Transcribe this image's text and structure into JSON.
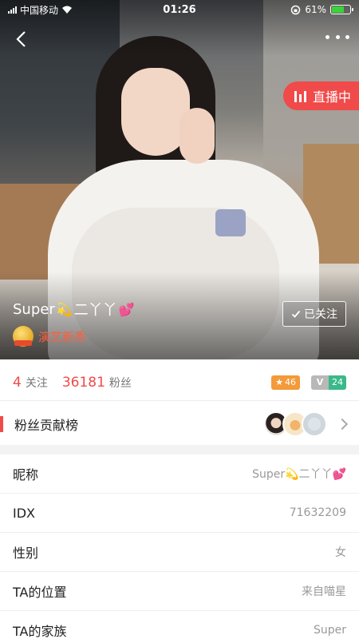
{
  "status_bar": {
    "carrier": "中国移动",
    "time": "01:26",
    "battery_percent": "61%",
    "battery_level": 0.61,
    "icons": [
      "signal-icon",
      "wifi-icon",
      "rotation-lock-icon",
      "battery-icon"
    ]
  },
  "top_bar": {
    "back_icon": "chevron-left-icon",
    "more_icon": "more-dots-icon"
  },
  "live_badge": {
    "label": "直播中",
    "icon": "live-bars-icon"
  },
  "profile": {
    "name": "Super",
    "name_emoji_1": "💫",
    "name_suffix": "二丫丫",
    "name_emoji_2": "💕",
    "talent_label": "演艺新秀",
    "follow_label": "已关注"
  },
  "stats": {
    "following_count": "4",
    "following_label": "关注",
    "fans_count": "36181",
    "fans_label": "粉丝",
    "level_star": "46",
    "level_v": "V",
    "level_v_num": "24"
  },
  "contribution": {
    "label": "粉丝贡献榜"
  },
  "info_rows": [
    {
      "label": "昵称",
      "value": "Super💫二丫丫💕"
    },
    {
      "label": "IDX",
      "value": "71632209"
    },
    {
      "label": "性别",
      "value": "女"
    },
    {
      "label": "TA的位置",
      "value": "来自喵星"
    },
    {
      "label": "TA的家族",
      "value": "Super"
    }
  ],
  "colors": {
    "accent_red": "#f04a4a",
    "talent_orange": "#ff5d3a",
    "badge_star": "#f39a3a",
    "badge_green": "#3ab98a"
  }
}
